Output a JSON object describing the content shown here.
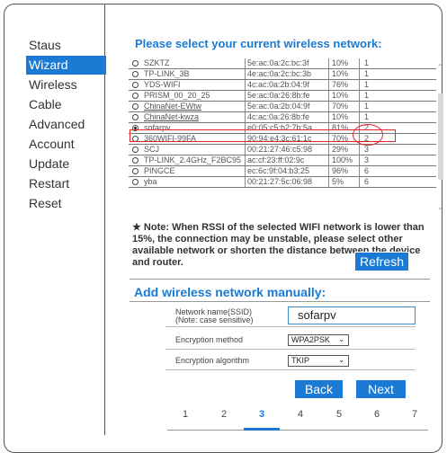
{
  "nav": {
    "items": [
      {
        "label": "Staus",
        "active": false
      },
      {
        "label": "Wizard",
        "active": true
      },
      {
        "label": "Wireless",
        "active": false
      },
      {
        "label": "Cable",
        "active": false
      },
      {
        "label": "Advanced",
        "active": false
      },
      {
        "label": "Account",
        "active": false
      },
      {
        "label": "Update",
        "active": false
      },
      {
        "label": "Restart",
        "active": false
      },
      {
        "label": "Reset",
        "active": false
      }
    ]
  },
  "section_title": "Please select your current wireless network:",
  "networks": [
    {
      "ssid": "SZKTZ",
      "mac": "5e:ac:0a:2c:bc:3f",
      "rssi": "10%",
      "channel": "1",
      "underline": false
    },
    {
      "ssid": "TP-LINK_3B",
      "mac": "4e:ac:0a:2c:bc:3b",
      "rssi": "10%",
      "channel": "1",
      "underline": false
    },
    {
      "ssid": "YDS-WIFI",
      "mac": "4c:ac:0a:2b:04:9f",
      "rssi": "76%",
      "channel": "1",
      "underline": false
    },
    {
      "ssid": "PRISM_00_20_25",
      "mac": "5e:ac:0a:26:8b:fe",
      "rssi": "10%",
      "channel": "1",
      "underline": false
    },
    {
      "ssid": "ChinaNet-EWtw",
      "mac": "5e:ac:0a:2b:04:9f",
      "rssi": "70%",
      "channel": "1",
      "underline": true
    },
    {
      "ssid": "ChinaNet-kwza",
      "mac": "4c:ac:0a:26:8b:fe",
      "rssi": "10%",
      "channel": "1",
      "underline": true
    },
    {
      "ssid": "sofarpv",
      "mac": "e0:05:c5:b2:7b:5a",
      "rssi": "81%",
      "channel": "2",
      "underline": false,
      "selected": true
    },
    {
      "ssid": "360WIFI-99FA",
      "mac": "90:94:e4:3c:61:1c",
      "rssi": "70%",
      "channel": "2",
      "underline": false
    },
    {
      "ssid": "SCJ",
      "mac": "00:21:27:46:c5:98",
      "rssi": "29%",
      "channel": "3",
      "underline": false
    },
    {
      "ssid": "TP-LINK_2.4GHz_F2BC95",
      "mac": "ac:cf:23:ff:02:9c",
      "rssi": "100%",
      "channel": "3",
      "underline": false
    },
    {
      "ssid": "PINGCE",
      "mac": "ec:6c:9f:04:b3:25",
      "rssi": "96%",
      "channel": "6",
      "underline": false
    },
    {
      "ssid": "yba",
      "mac": "00:21:27:5c:06:98",
      "rssi": "5%",
      "channel": "6",
      "underline": false
    }
  ],
  "note": "★ Note: When RSSI of the selected WIFI network is lower than 15%, the connection may be unstable, please select other available network or shorten the distance between the device and router.",
  "refresh_label": "Refresh",
  "manual": {
    "title": "Add wireless network manually:",
    "ssid_label_1": "Network name(SSID)",
    "ssid_label_2": "(Note: case sensitive)",
    "ssid_value": "sofarpv",
    "enc_label": "Encryption method",
    "enc_value": "WPA2PSK",
    "alg_label": "Encryption algorithm",
    "alg_value": "TKIP"
  },
  "buttons": {
    "back": "Back",
    "next": "Next"
  },
  "steps": [
    "1",
    "2",
    "3",
    "4",
    "5",
    "6",
    "7"
  ],
  "active_step": "3",
  "colors": {
    "accent": "#1a7ad4",
    "highlight": "#e0242a"
  }
}
